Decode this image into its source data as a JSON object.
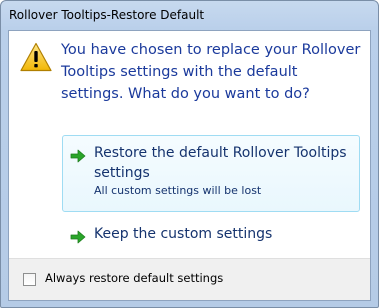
{
  "window": {
    "title": "Rollover Tooltips-Restore Default"
  },
  "dialog": {
    "icon": "warning-icon",
    "instruction": "You have chosen to replace your Rollover Tooltips settings with the default settings. What do you want to do?",
    "options": [
      {
        "icon": "green-arrow-icon",
        "label": "Restore the default Rollover Tooltips settings",
        "note": "All custom settings will be lost"
      },
      {
        "icon": "green-arrow-icon",
        "label": "Keep the custom settings"
      }
    ],
    "footer": {
      "checkbox_label": "Always restore default settings",
      "checked": false
    }
  },
  "colors": {
    "instruction": "#1b3a9c",
    "link_text": "#15336e",
    "hover_border": "#9fdcf3",
    "arrow": "#2aa52a",
    "warning": "#f5c518"
  }
}
